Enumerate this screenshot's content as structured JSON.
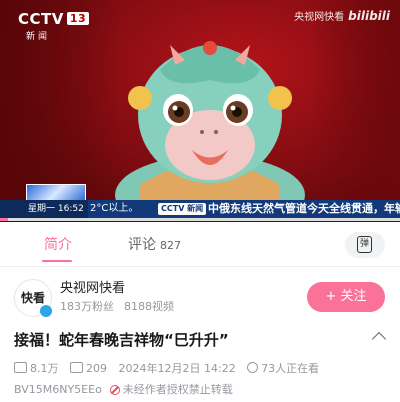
{
  "video": {
    "channel_logo": "CCTV",
    "channel_number": "13",
    "channel_sub": "新闻",
    "watermark_text": "央视网快看",
    "watermark_brand": "bilibili",
    "ticker_time": "星期一  16:52",
    "ticker_temp": "2°C以上。",
    "ticker_brand": "CCTV 新闻",
    "ticker_headline": "中俄东线天然气管道今天全线贯通，年输",
    "progress_percent": 2
  },
  "tabs": {
    "intro_label": "简介",
    "comments_label": "评论",
    "comments_count": "827",
    "danmu_icon": "弹"
  },
  "uploader": {
    "avatar_text": "快看",
    "name": "央视网快看",
    "fans": "183万粉丝",
    "videos": "8188视频",
    "follow_label": "+ 关注"
  },
  "video_info": {
    "title": "接福！蛇年春晚吉祥物“巳升升”",
    "views": "8.1万",
    "danmaku": "209",
    "datetime": "2024年12月2日 14:22",
    "watching": "73人正在看",
    "bvid": "BV15M6NY5EEo",
    "notice": "未经作者授权禁止转载"
  },
  "colors": {
    "accent": "#fb7299",
    "ticker_bg": "#123a7a",
    "video_bg": "#b4141a"
  }
}
